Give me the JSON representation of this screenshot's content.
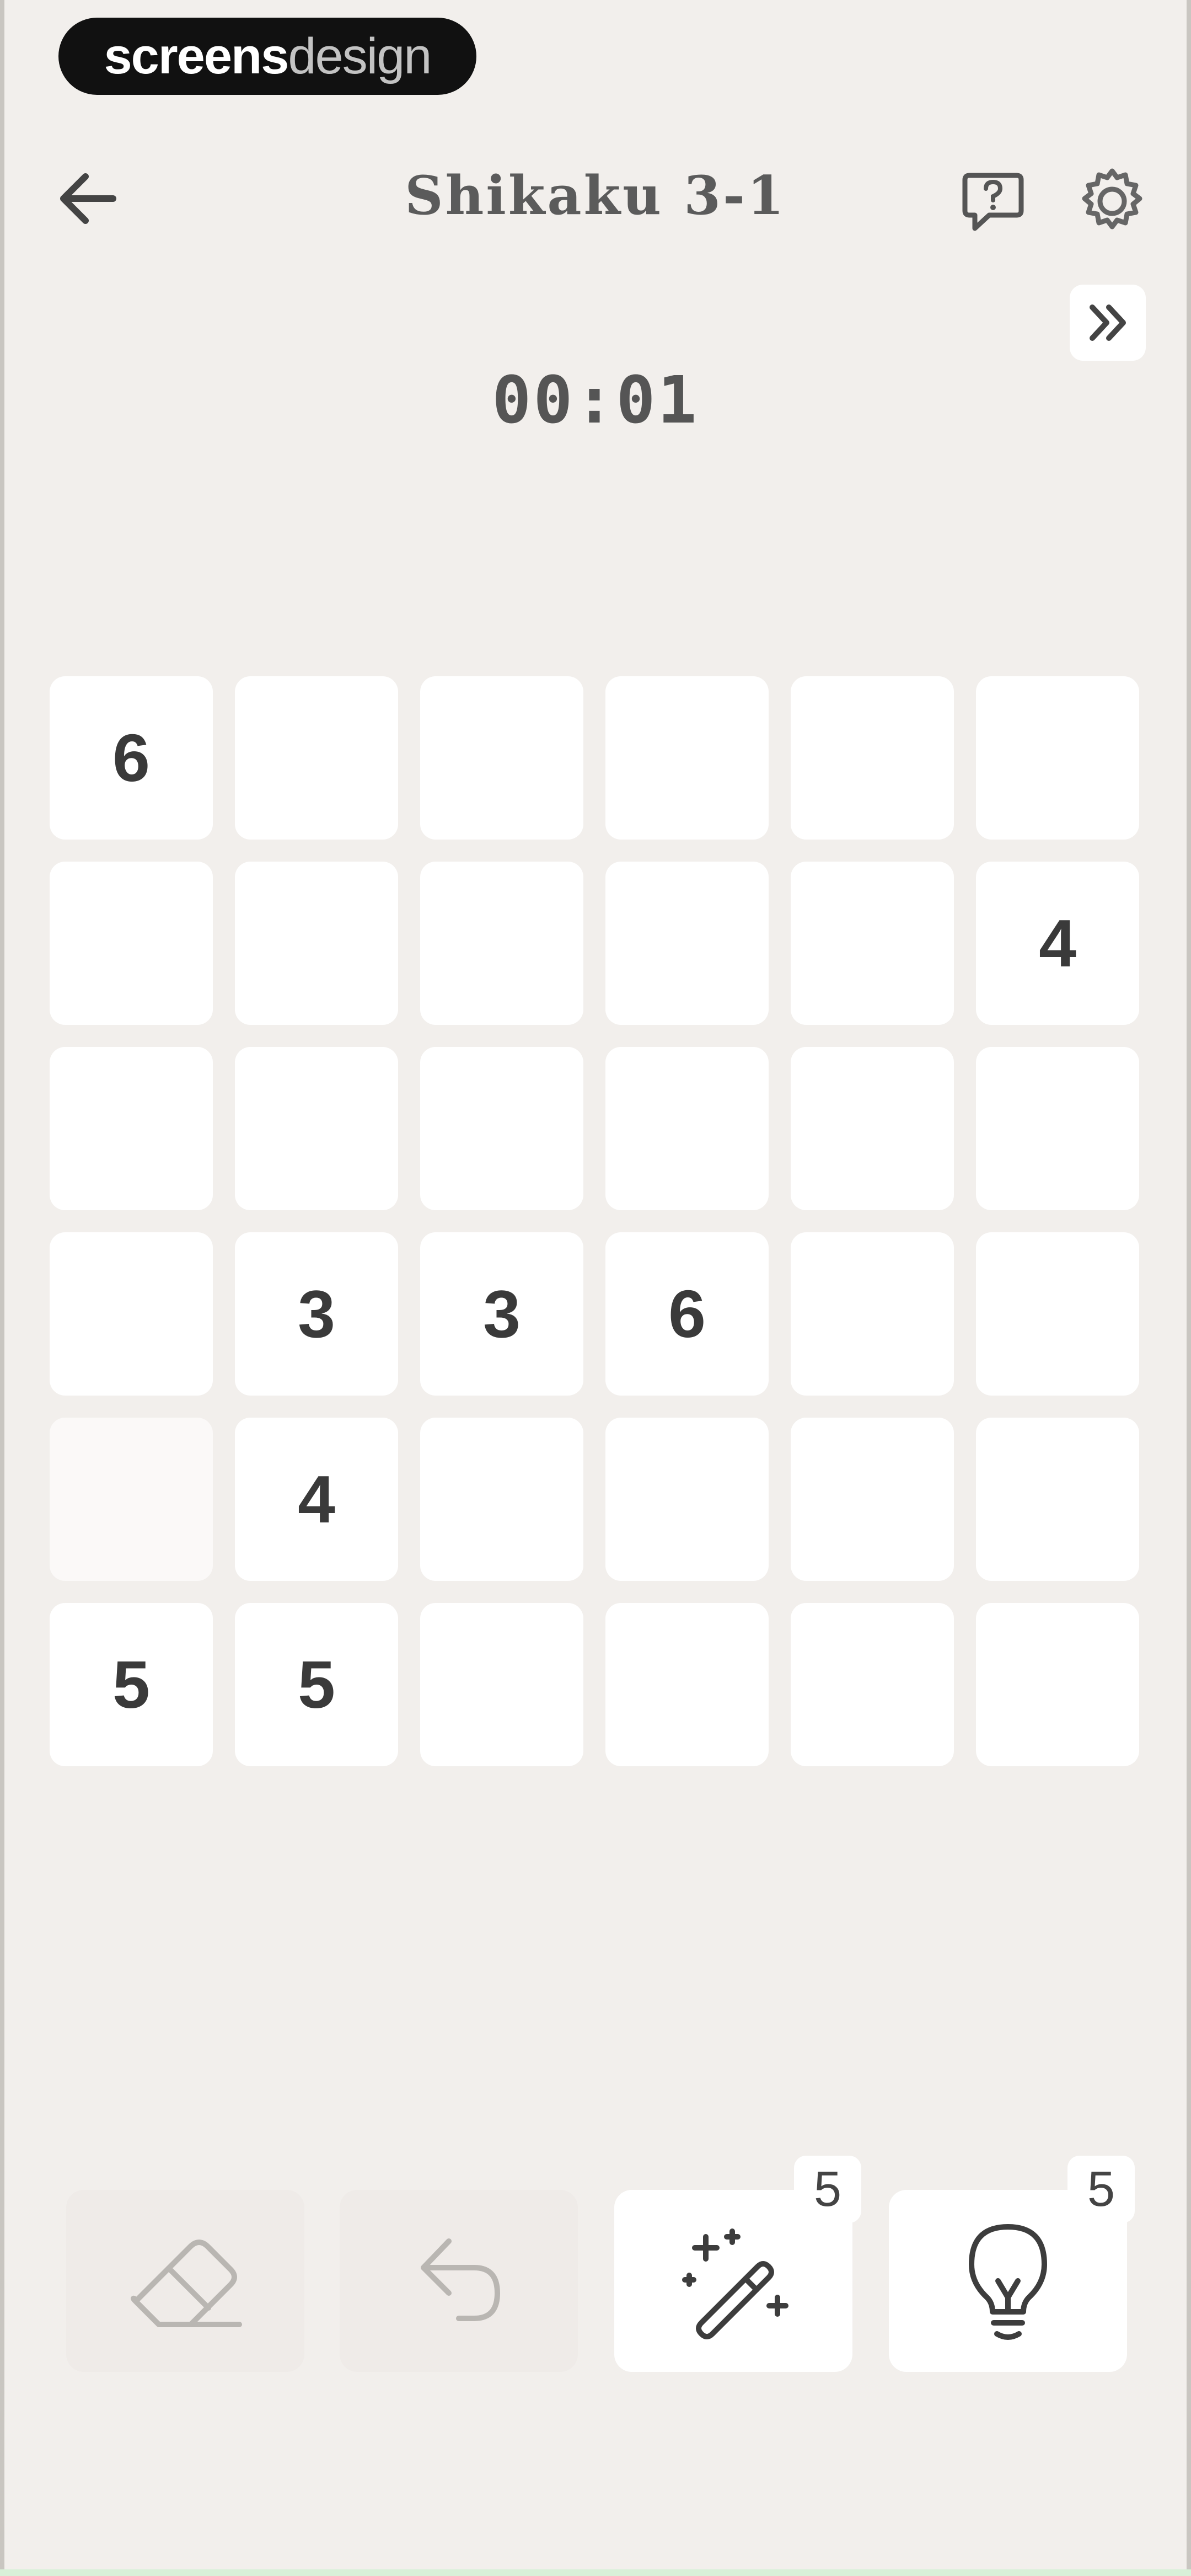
{
  "brand": {
    "bold": "screens",
    "light": "design"
  },
  "header": {
    "title": "Shikaku 3-1",
    "back_icon": "arrow-left-icon",
    "help_icon": "help-bubble-icon",
    "settings_icon": "gear-icon",
    "skip_icon": "double-chevron-right-icon"
  },
  "timer": "00:01",
  "grid": {
    "rows": [
      [
        "6",
        "",
        "",
        "",
        "",
        ""
      ],
      [
        "",
        "",
        "",
        "",
        "",
        "4"
      ],
      [
        "",
        "",
        "",
        "",
        "",
        ""
      ],
      [
        "",
        "3",
        "3",
        "6",
        "",
        ""
      ],
      [
        "",
        "4",
        "",
        "",
        "",
        ""
      ],
      [
        "5",
        "5",
        "",
        "",
        "",
        ""
      ]
    ]
  },
  "toolbar": {
    "eraser": {
      "icon": "eraser-icon",
      "enabled": false
    },
    "undo": {
      "icon": "undo-icon",
      "enabled": false
    },
    "magic": {
      "icon": "magic-wand-icon",
      "count": "5",
      "enabled": true
    },
    "hint": {
      "icon": "lightbulb-icon",
      "count": "5",
      "enabled": true
    }
  },
  "colors": {
    "background": "#f2efec",
    "cell": "#ffffff",
    "text": "#3a3a3a"
  }
}
